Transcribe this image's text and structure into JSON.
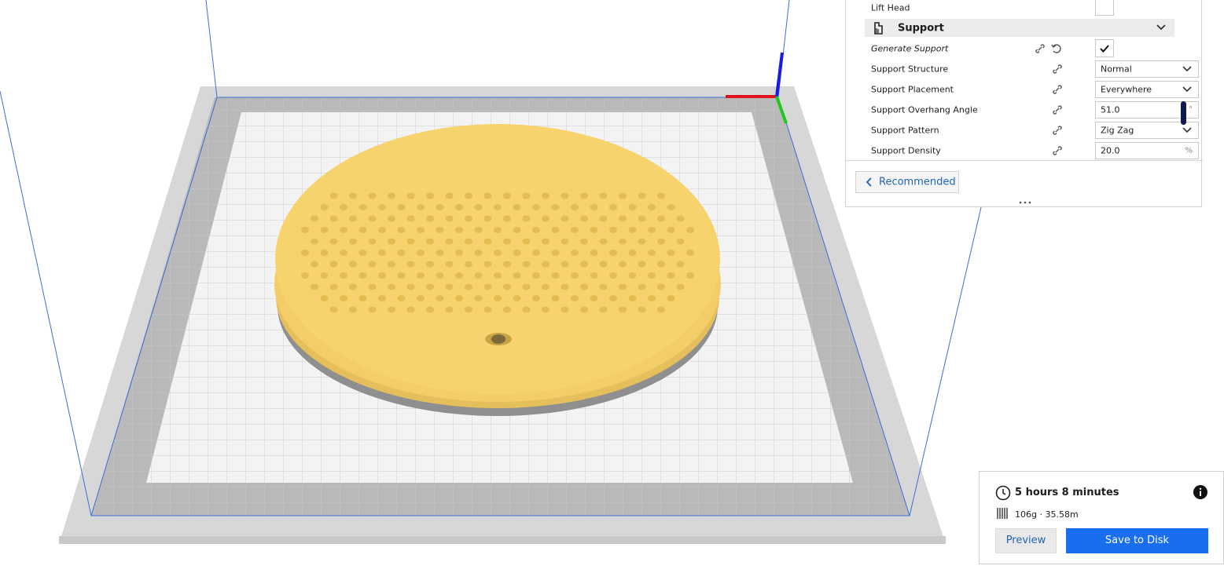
{
  "settings": {
    "lift_head_label": "Lift Head",
    "category_label": "Support",
    "rows": [
      {
        "label": "Generate Support"
      },
      {
        "label": "Support Structure",
        "value": "Normal"
      },
      {
        "label": "Support Placement",
        "value": "Everywhere"
      },
      {
        "label": "Support Overhang Angle",
        "value": "51.0",
        "unit": "°"
      },
      {
        "label": "Support Pattern",
        "value": "Zig Zag"
      },
      {
        "label": "Support Density",
        "value": "20.0",
        "unit": "%"
      }
    ],
    "recommended_label": "Recommended"
  },
  "print_info": {
    "time": "5 hours 8 minutes",
    "material": "106g · 35.58m",
    "preview_label": "Preview",
    "save_label": "Save to Disk"
  },
  "colors": {
    "accent": "#196ef0",
    "model": "#f7d36d",
    "link_text": "#1f65b0",
    "axis_x": "#e0141c",
    "axis_y": "#22c81e",
    "axis_z": "#1a1ae0"
  }
}
